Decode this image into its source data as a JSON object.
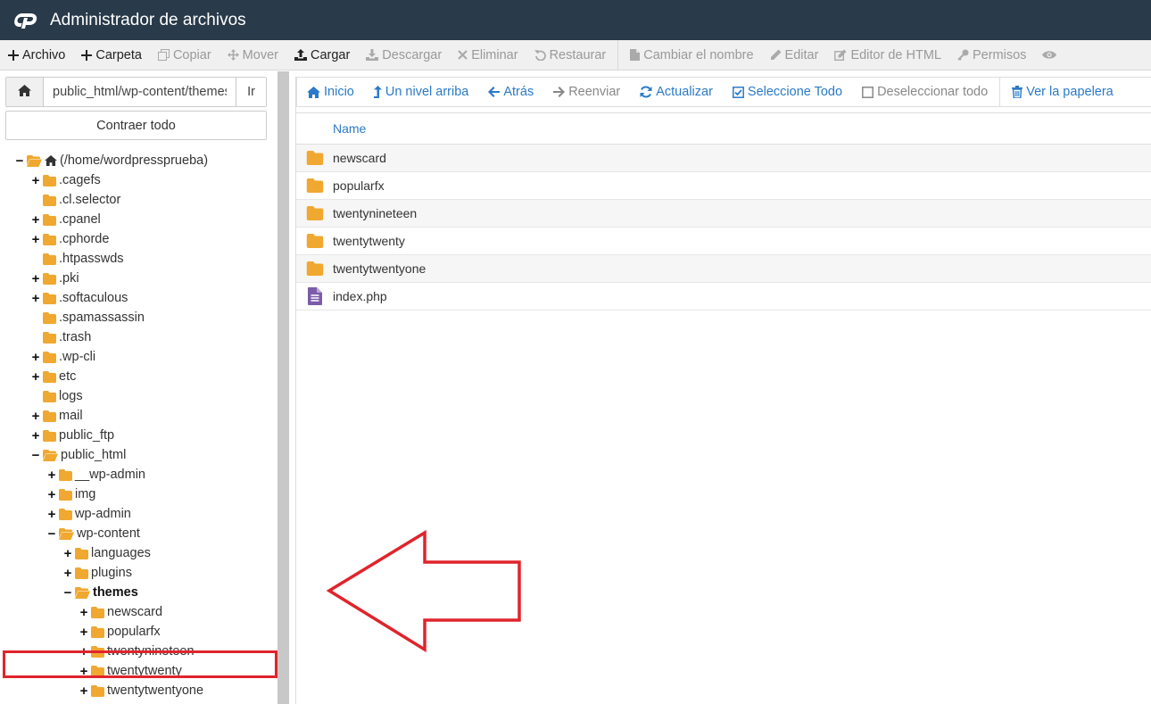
{
  "header": {
    "title": "Administrador de archivos"
  },
  "toolbar": {
    "items": [
      {
        "label": "Archivo",
        "icon": "plus-icon",
        "enabled": true
      },
      {
        "label": "Carpeta",
        "icon": "plus-icon",
        "enabled": true
      },
      {
        "label": "Copiar",
        "icon": "copy-icon",
        "enabled": false
      },
      {
        "label": "Mover",
        "icon": "move-icon",
        "enabled": false
      },
      {
        "label": "Cargar",
        "icon": "upload-icon",
        "enabled": true
      },
      {
        "label": "Descargar",
        "icon": "download-icon",
        "enabled": false
      },
      {
        "label": "Eliminar",
        "icon": "close-icon",
        "enabled": false
      },
      {
        "label": "Restaurar",
        "icon": "undo-icon",
        "enabled": false
      },
      {
        "label": "Cambiar el nombre",
        "icon": "file-icon",
        "enabled": false
      },
      {
        "label": "Editar",
        "icon": "pencil-icon",
        "enabled": false
      },
      {
        "label": "Editor de HTML",
        "icon": "edit-icon",
        "enabled": false
      },
      {
        "label": "Permisos",
        "icon": "key-icon",
        "enabled": false
      }
    ]
  },
  "left": {
    "path_value": "public_html/wp-content/themes",
    "go_label": "Ir",
    "collapse_label": "Contraer todo",
    "tree": [
      {
        "label": "(/home/wordpressprueba)",
        "level": 0,
        "toggle": "−",
        "open": true,
        "home": true
      },
      {
        "label": ".cagefs",
        "level": 1,
        "toggle": "+"
      },
      {
        "label": ".cl.selector",
        "level": 1,
        "toggle": ""
      },
      {
        "label": ".cpanel",
        "level": 1,
        "toggle": "+"
      },
      {
        "label": ".cphorde",
        "level": 1,
        "toggle": "+"
      },
      {
        "label": ".htpasswds",
        "level": 1,
        "toggle": ""
      },
      {
        "label": ".pki",
        "level": 1,
        "toggle": "+"
      },
      {
        "label": ".softaculous",
        "level": 1,
        "toggle": "+"
      },
      {
        "label": ".spamassassin",
        "level": 1,
        "toggle": ""
      },
      {
        "label": ".trash",
        "level": 1,
        "toggle": ""
      },
      {
        "label": ".wp-cli",
        "level": 1,
        "toggle": "+"
      },
      {
        "label": "etc",
        "level": 1,
        "toggle": "+"
      },
      {
        "label": "logs",
        "level": 1,
        "toggle": ""
      },
      {
        "label": "mail",
        "level": 1,
        "toggle": "+"
      },
      {
        "label": "public_ftp",
        "level": 1,
        "toggle": "+"
      },
      {
        "label": "public_html",
        "level": 1,
        "toggle": "−",
        "open": true
      },
      {
        "label": "__wp-admin",
        "level": 2,
        "toggle": "+"
      },
      {
        "label": "img",
        "level": 2,
        "toggle": "+"
      },
      {
        "label": "wp-admin",
        "level": 2,
        "toggle": "+"
      },
      {
        "label": "wp-content",
        "level": 2,
        "toggle": "−",
        "open": true
      },
      {
        "label": "languages",
        "level": 3,
        "toggle": "+"
      },
      {
        "label": "plugins",
        "level": 3,
        "toggle": "+"
      },
      {
        "label": "themes",
        "level": 3,
        "toggle": "−",
        "open": true,
        "selected": true
      },
      {
        "label": "newscard",
        "level": 4,
        "toggle": "+"
      },
      {
        "label": "popularfx",
        "level": 4,
        "toggle": "+"
      },
      {
        "label": "twentynineteen",
        "level": 4,
        "toggle": "+"
      },
      {
        "label": "twentytwenty",
        "level": 4,
        "toggle": "+"
      },
      {
        "label": "twentytwentyone",
        "level": 4,
        "toggle": "+"
      }
    ]
  },
  "nav": {
    "items": [
      {
        "label": "Inicio",
        "icon": "home-icon",
        "enabled": true
      },
      {
        "label": "Un nivel arriba",
        "icon": "level-up-icon",
        "enabled": true
      },
      {
        "label": "Atrás",
        "icon": "arrow-left-icon",
        "enabled": true
      },
      {
        "label": "Reenviar",
        "icon": "arrow-right-icon",
        "enabled": false
      },
      {
        "label": "Actualizar",
        "icon": "refresh-icon",
        "enabled": true
      },
      {
        "label": "Seleccione Todo",
        "icon": "check-square-icon",
        "enabled": true
      },
      {
        "label": "Deseleccionar todo",
        "icon": "square-icon",
        "enabled": false
      },
      {
        "label": "Ver la papelera",
        "icon": "trash-icon",
        "enabled": true
      }
    ]
  },
  "files": {
    "column_name": "Name",
    "rows": [
      {
        "name": "newscard",
        "type": "folder"
      },
      {
        "name": "popularfx",
        "type": "folder"
      },
      {
        "name": "twentynineteen",
        "type": "folder"
      },
      {
        "name": "twentytwenty",
        "type": "folder"
      },
      {
        "name": "twentytwentyone",
        "type": "folder"
      },
      {
        "name": "index.php",
        "type": "file"
      }
    ]
  },
  "colors": {
    "header_bg": "#293a4a",
    "link_blue": "#2a7ac7",
    "folder_orange": "#f0a830",
    "highlight_red": "#e0242c",
    "file_purple": "#7a5ca8"
  }
}
